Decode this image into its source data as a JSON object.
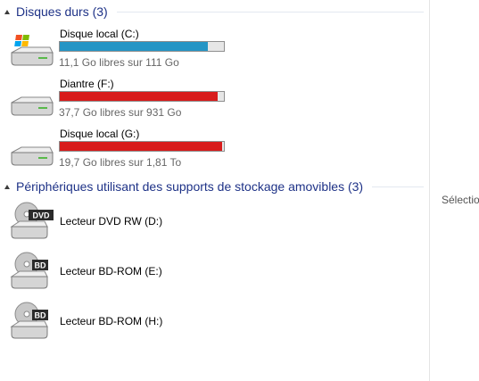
{
  "groups": [
    {
      "title": "Disques durs (3)",
      "items": [
        {
          "name": "Disque local (C:)",
          "free": "11,1 Go libres sur 111 Go",
          "used_fraction": 0.9,
          "bar_color": "#2595c5",
          "icon": "windows-drive-icon"
        },
        {
          "name": "Diantre (F:)",
          "free": "37,7 Go libres sur 931 Go",
          "used_fraction": 0.96,
          "bar_color": "#d81b1b",
          "icon": "hard-drive-icon"
        },
        {
          "name": "Disque local (G:)",
          "free": "19,7 Go libres sur 1,81 To",
          "used_fraction": 0.99,
          "bar_color": "#d81b1b",
          "icon": "hard-drive-icon"
        }
      ]
    },
    {
      "title": "Périphériques utilisant des supports de stockage amovibles (3)",
      "items": [
        {
          "name": "Lecteur DVD RW (D:)",
          "badge": "DVD",
          "icon": "dvd-drive-icon"
        },
        {
          "name": "Lecteur BD-ROM (E:)",
          "badge": "BD",
          "icon": "bd-drive-icon"
        },
        {
          "name": "Lecteur BD-ROM (H:)",
          "badge": "BD",
          "icon": "bd-drive-icon"
        }
      ]
    }
  ],
  "details_pane": {
    "text": "Sélectio"
  }
}
